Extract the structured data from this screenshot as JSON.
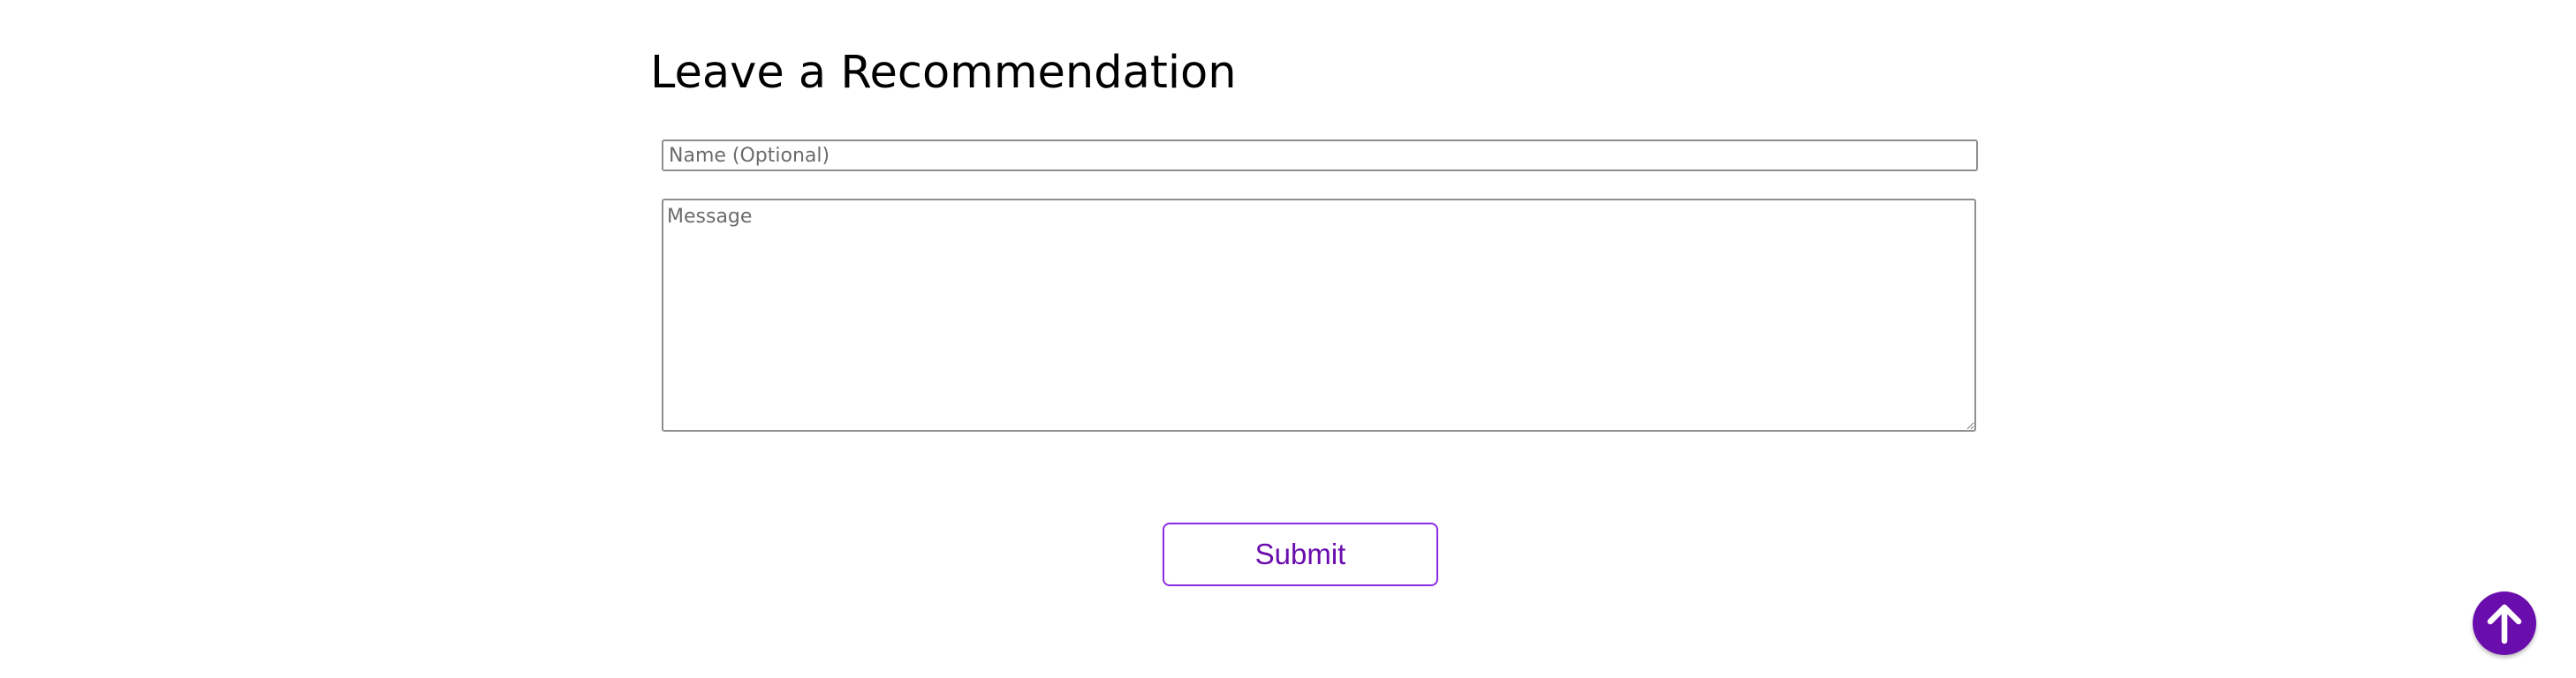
{
  "form": {
    "title": "Leave a Recommendation",
    "name_placeholder": "Name (Optional)",
    "name_value": "",
    "message_placeholder": "Message",
    "message_value": "",
    "submit_label": "Submit"
  },
  "scroll_top": {
    "icon": "arrow-up-icon"
  },
  "colors": {
    "accent": "#6a0dad",
    "accent_border": "#8a2be2",
    "input_border": "#8f8f8f"
  }
}
